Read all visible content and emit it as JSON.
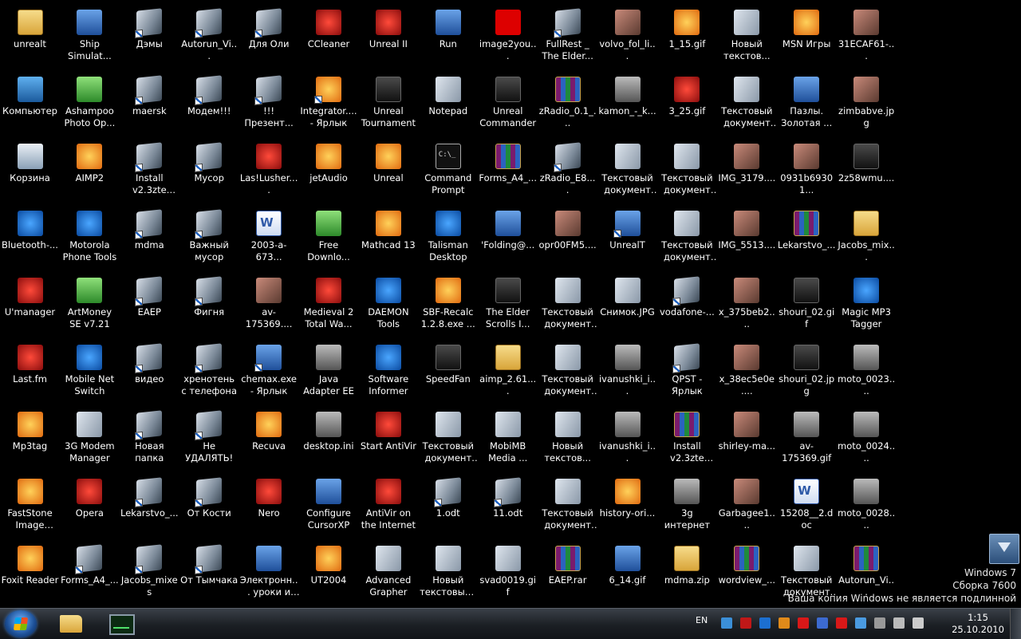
{
  "desktop": {
    "icons": [
      {
        "label": "unrealt",
        "icon": "folder-icon",
        "kind": "folder"
      },
      {
        "label": "Ship Simulat...",
        "icon": "ship-simulator-icon",
        "kind": "exe"
      },
      {
        "label": "Дэмы",
        "icon": "shortcut-icon",
        "kind": "doc"
      },
      {
        "label": "Autorun_Vi...",
        "icon": "shortcut-icon",
        "kind": "doc"
      },
      {
        "label": "Для Оли",
        "icon": "shortcut-icon",
        "kind": "doc"
      },
      {
        "label": "CCleaner",
        "icon": "ccleaner-icon",
        "kind": "red"
      },
      {
        "label": "Unreal II",
        "icon": "unreal-2-icon",
        "kind": "red"
      },
      {
        "label": "Run",
        "icon": "run-icon",
        "kind": "exe"
      },
      {
        "label": "image2you...",
        "icon": "red-dot-icon",
        "kind": "tiny"
      },
      {
        "label": "FullRest _ The Elder...",
        "icon": "shortcut-icon",
        "kind": "doc"
      },
      {
        "label": "volvo_fol_li...",
        "icon": "image-file-icon",
        "kind": "img"
      },
      {
        "label": "1_15.gif",
        "icon": "road-sign-icon",
        "kind": "orange"
      },
      {
        "label": "Новый текстов...",
        "icon": "text-document-icon",
        "kind": "txt"
      },
      {
        "label": "MSN Игры",
        "icon": "msn-butterfly-icon",
        "kind": "orange"
      },
      {
        "label": "31ECAF61-...",
        "icon": "photo-icon",
        "kind": "img"
      },
      {
        "label": "Компьютер",
        "icon": "computer-icon",
        "kind": "pc"
      },
      {
        "label": "Ashampoo Photo Op...",
        "icon": "ashampoo-icon",
        "kind": "green"
      },
      {
        "label": "maersk",
        "icon": "shortcut-icon",
        "kind": "doc"
      },
      {
        "label": "Модем!!!",
        "icon": "shortcut-icon",
        "kind": "doc"
      },
      {
        "label": "!!!Презент...",
        "icon": "shortcut-icon",
        "kind": "doc"
      },
      {
        "label": "Integrator.... - Ярлык",
        "icon": "integrator-icon",
        "kind": "orange"
      },
      {
        "label": "Unreal Tournament",
        "icon": "unreal-tournament-icon",
        "kind": "dark"
      },
      {
        "label": "Notepad",
        "icon": "notepad-icon",
        "kind": "txt"
      },
      {
        "label": "Unreal Commander",
        "icon": "unreal-commander-icon",
        "kind": "dark"
      },
      {
        "label": "zRadio_0.1_...",
        "icon": "archive-icon",
        "kind": "rar"
      },
      {
        "label": "kamon_-_k...",
        "icon": "audio-file-icon",
        "kind": "gray"
      },
      {
        "label": "3_25.gif",
        "icon": "no-entry-sign-icon",
        "kind": "red"
      },
      {
        "label": "Текстовый документ ...",
        "icon": "text-document-icon",
        "kind": "txt"
      },
      {
        "label": "Пазлы. Золотая ...",
        "icon": "puzzle-icon",
        "kind": "exe"
      },
      {
        "label": "zimbabve.jpg",
        "icon": "photo-icon",
        "kind": "img"
      },
      {
        "label": "Корзина",
        "icon": "recycle-bin-icon",
        "kind": "bin"
      },
      {
        "label": "AIMP2",
        "icon": "aimp-icon",
        "kind": "orange"
      },
      {
        "label": "Install v2.3zte MF626",
        "icon": "shortcut-icon",
        "kind": "doc"
      },
      {
        "label": "Мусор",
        "icon": "shortcut-icon",
        "kind": "doc"
      },
      {
        "label": "Las!Lusher....",
        "icon": "color-squares-icon",
        "kind": "red"
      },
      {
        "label": "jetAudio",
        "icon": "jetaudio-icon",
        "kind": "orange"
      },
      {
        "label": "Unreal",
        "icon": "unreal-icon",
        "kind": "orange"
      },
      {
        "label": "Command Prompt",
        "icon": "command-prompt-icon",
        "kind": "cmd"
      },
      {
        "label": "Forms_A4_...",
        "icon": "archive-icon",
        "kind": "rar"
      },
      {
        "label": "zRadio_E8....",
        "icon": "shortcut-icon",
        "kind": "doc"
      },
      {
        "label": "Текстовый документ ...",
        "icon": "text-document-icon",
        "kind": "txt"
      },
      {
        "label": "Текстовый документ ...",
        "icon": "text-document-icon",
        "kind": "txt"
      },
      {
        "label": "IMG_3179....",
        "icon": "photo-icon",
        "kind": "img"
      },
      {
        "label": "0931b69301...",
        "icon": "photo-icon",
        "kind": "img"
      },
      {
        "label": "2z58wmu....",
        "icon": "photo-icon",
        "kind": "dark"
      },
      {
        "label": "Bluetooth-...",
        "icon": "bluetooth-icon",
        "kind": "blue-circle"
      },
      {
        "label": "Motorola Phone Tools",
        "icon": "motorola-icon",
        "kind": "blue-circle"
      },
      {
        "label": "mdma",
        "icon": "shortcut-icon",
        "kind": "doc"
      },
      {
        "label": "Важный мусор",
        "icon": "shortcut-icon",
        "kind": "doc"
      },
      {
        "label": "2003-a-673...",
        "icon": "word-document-icon",
        "kind": "word"
      },
      {
        "label": "Free Downlo...",
        "icon": "download-manager-icon",
        "kind": "green"
      },
      {
        "label": "Mathcad 13",
        "icon": "mathcad-icon",
        "kind": "orange"
      },
      {
        "label": "Talisman Desktop",
        "icon": "talisman-icon",
        "kind": "blue-circle"
      },
      {
        "label": "'Folding@...",
        "icon": "folding-at-home-icon",
        "kind": "exe"
      },
      {
        "label": "opr00FM5....",
        "icon": "photo-icon",
        "kind": "img"
      },
      {
        "label": "UnrealT",
        "icon": "shortcut-icon",
        "kind": "exe"
      },
      {
        "label": "Текстовый документ ...",
        "icon": "text-document-icon",
        "kind": "txt"
      },
      {
        "label": "IMG_5513....",
        "icon": "photo-icon",
        "kind": "img"
      },
      {
        "label": "Lekarstvo_...",
        "icon": "archive-icon",
        "kind": "rar"
      },
      {
        "label": "Jacobs_mix...",
        "icon": "zip-folder-icon",
        "kind": "folder"
      },
      {
        "label": "U'manager",
        "icon": "utel-icon",
        "kind": "red"
      },
      {
        "label": "ArtMoney SE v7.21",
        "icon": "artmoney-icon",
        "kind": "green"
      },
      {
        "label": "EAEP",
        "icon": "shortcut-icon",
        "kind": "doc"
      },
      {
        "label": "Фигня",
        "icon": "shortcut-icon",
        "kind": "doc"
      },
      {
        "label": "av-175369....",
        "icon": "photo-icon",
        "kind": "img"
      },
      {
        "label": "Medieval 2 Total Wa...",
        "icon": "medieval-icon",
        "kind": "red"
      },
      {
        "label": "DAEMON Tools",
        "icon": "daemon-tools-icon",
        "kind": "blue-circle"
      },
      {
        "label": "SBF-Recalc 1.2.8.exe ...",
        "icon": "sbf-recalc-icon",
        "kind": "orange"
      },
      {
        "label": "The Elder Scrolls I...",
        "icon": "elder-scrolls-icon",
        "kind": "dark"
      },
      {
        "label": "Текстовый документ ...",
        "icon": "text-document-icon",
        "kind": "txt"
      },
      {
        "label": "Снимок.JPG",
        "icon": "image-file-icon",
        "kind": "txt"
      },
      {
        "label": "vodafone-...",
        "icon": "shortcut-icon",
        "kind": "doc"
      },
      {
        "label": "x_375beb2....",
        "icon": "photo-icon",
        "kind": "img"
      },
      {
        "label": "shouri_02.gif",
        "icon": "photo-icon",
        "kind": "dark"
      },
      {
        "label": "Magic MP3 Tagger",
        "icon": "magic-mp3-icon",
        "kind": "blue-circle"
      },
      {
        "label": "Last.fm",
        "icon": "lastfm-icon",
        "kind": "red"
      },
      {
        "label": "Mobile Net Switch",
        "icon": "mobile-net-switch-icon",
        "kind": "blue-circle"
      },
      {
        "label": "видео",
        "icon": "shortcut-icon",
        "kind": "doc"
      },
      {
        "label": "хренотень с телефона",
        "icon": "shortcut-icon",
        "kind": "doc"
      },
      {
        "label": "chemax.exe - Ярлык",
        "icon": "chemax-icon",
        "kind": "exe"
      },
      {
        "label": "Java Adapter EE",
        "icon": "java-adapter-icon",
        "kind": "gray"
      },
      {
        "label": "Software Informer",
        "icon": "software-informer-icon",
        "kind": "blue-circle"
      },
      {
        "label": "SpeedFan",
        "icon": "speedfan-icon",
        "kind": "dark"
      },
      {
        "label": "aimp_2.61....",
        "icon": "zip-folder-icon",
        "kind": "folder"
      },
      {
        "label": "Текстовый документ ...",
        "icon": "text-document-icon",
        "kind": "txt"
      },
      {
        "label": "ivanushki_i...",
        "icon": "audio-file-icon",
        "kind": "gray"
      },
      {
        "label": "QPST - Ярлык",
        "icon": "qpst-icon",
        "kind": "doc"
      },
      {
        "label": "x_38ec5e0e....",
        "icon": "photo-icon",
        "kind": "img"
      },
      {
        "label": "shouri_02.jpg",
        "icon": "photo-icon",
        "kind": "dark"
      },
      {
        "label": "moto_0023....",
        "icon": "photo-icon",
        "kind": "gray"
      },
      {
        "label": "Mp3tag",
        "icon": "mp3tag-icon",
        "kind": "orange"
      },
      {
        "label": "3G Modem Manager",
        "icon": "modem-manager-icon",
        "kind": "txt"
      },
      {
        "label": "Новая папка",
        "icon": "shortcut-icon",
        "kind": "doc"
      },
      {
        "label": "Не УДАЛЯТЬ!",
        "icon": "shortcut-icon",
        "kind": "doc"
      },
      {
        "label": "Recuva",
        "icon": "recuva-icon",
        "kind": "orange"
      },
      {
        "label": "desktop.ini",
        "icon": "settings-file-icon",
        "kind": "gray"
      },
      {
        "label": "Start AntiVir",
        "icon": "antivir-icon",
        "kind": "red"
      },
      {
        "label": "Текстовый документ ...",
        "icon": "text-document-icon",
        "kind": "txt"
      },
      {
        "label": "MobiMB Media ...",
        "icon": "mobimb-icon",
        "kind": "txt"
      },
      {
        "label": "Новый текстов...",
        "icon": "text-document-icon",
        "kind": "txt"
      },
      {
        "label": "ivanushki_i...",
        "icon": "audio-file-icon",
        "kind": "gray"
      },
      {
        "label": "Install v2.3zte MF626.rar",
        "icon": "archive-icon",
        "kind": "rar"
      },
      {
        "label": "shirley-ma...",
        "icon": "photo-icon",
        "kind": "img"
      },
      {
        "label": "av-175369.gif",
        "icon": "photo-icon",
        "kind": "gray"
      },
      {
        "label": "moto_0024....",
        "icon": "photo-icon",
        "kind": "gray"
      },
      {
        "label": "FastStone Image Viewer",
        "icon": "faststone-icon",
        "kind": "orange"
      },
      {
        "label": "Opera",
        "icon": "opera-icon",
        "kind": "red"
      },
      {
        "label": "Lekarstvo_...",
        "icon": "shortcut-icon",
        "kind": "doc"
      },
      {
        "label": "От Кости",
        "icon": "shortcut-icon",
        "kind": "doc"
      },
      {
        "label": "Nero",
        "icon": "nero-icon",
        "kind": "red"
      },
      {
        "label": "Configure CursorXP",
        "icon": "cursorxp-icon",
        "kind": "exe"
      },
      {
        "label": "AntiVir on the Internet",
        "icon": "antivir-web-icon",
        "kind": "red"
      },
      {
        "label": "1.odt",
        "icon": "shortcut-icon",
        "kind": "doc"
      },
      {
        "label": "11.odt",
        "icon": "shortcut-icon",
        "kind": "doc"
      },
      {
        "label": "Текстовый документ ...",
        "icon": "text-document-icon",
        "kind": "txt"
      },
      {
        "label": "history-ori...",
        "icon": "pdf-icon",
        "kind": "orange"
      },
      {
        "label": "3g интернет",
        "icon": "modem-icon",
        "kind": "gray"
      },
      {
        "label": "Garbagee1....",
        "icon": "photo-icon",
        "kind": "img"
      },
      {
        "label": "15208__2.doc",
        "icon": "word-document-icon",
        "kind": "word"
      },
      {
        "label": "moto_0028....",
        "icon": "photo-icon",
        "kind": "gray"
      },
      {
        "label": "Foxit Reader",
        "icon": "foxit-icon",
        "kind": "orange"
      },
      {
        "label": "Forms_A4_...",
        "icon": "shortcut-icon",
        "kind": "doc"
      },
      {
        "label": "Jacobs_mixes",
        "icon": "shortcut-icon",
        "kind": "doc"
      },
      {
        "label": "От Тымчака",
        "icon": "shortcut-icon",
        "kind": "doc"
      },
      {
        "label": "Электронн... уроки и те...",
        "icon": "e-lessons-icon",
        "kind": "exe"
      },
      {
        "label": "UT2004",
        "icon": "ut2004-icon",
        "kind": "orange"
      },
      {
        "label": "Advanced Grapher",
        "icon": "grapher-icon",
        "kind": "txt"
      },
      {
        "label": "Новый текстовый...",
        "icon": "text-document-icon",
        "kind": "txt"
      },
      {
        "label": "svad0019.gif",
        "icon": "photo-icon",
        "kind": "txt"
      },
      {
        "label": "EAEP.rar",
        "icon": "archive-icon",
        "kind": "rar"
      },
      {
        "label": "6_14.gif",
        "icon": "road-sign-icon",
        "kind": "exe"
      },
      {
        "label": "mdma.zip",
        "icon": "zip-folder-icon",
        "kind": "folder"
      },
      {
        "label": "wordview_...",
        "icon": "archive-icon",
        "kind": "rar"
      },
      {
        "label": "Текстовый документ ...",
        "icon": "text-document-icon",
        "kind": "txt"
      },
      {
        "label": "Autorun_Vi...",
        "icon": "archive-icon",
        "kind": "rar"
      }
    ]
  },
  "watermark": {
    "line1": "Windows 7",
    "line2": "Сборка 7600",
    "line3": "Ваша копия Windows не является подлинной"
  },
  "taskbar": {
    "language": "EN",
    "time": "1:15",
    "date": "25.10.2010",
    "tray_icons": [
      "network-manager-icon",
      "lingvo-icon",
      "bluetooth-icon",
      "download-icon",
      "ati-icon",
      "quicktime-icon",
      "antivir-icon",
      "hardware-icon",
      "flag-icon",
      "action-center-icon",
      "volume-icon"
    ],
    "tray_colors": [
      "#3b8fd8",
      "#c01818",
      "#1c6fd0",
      "#e08a1a",
      "#d81818",
      "#3c6ad0",
      "#d81818",
      "#4a9ae0",
      "#999999",
      "#bbbbbb",
      "#cccccc"
    ]
  }
}
